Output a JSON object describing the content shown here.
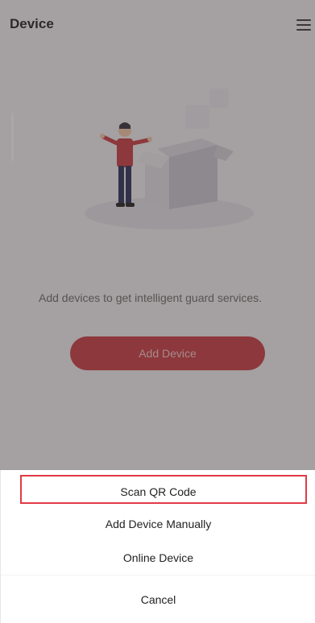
{
  "header": {
    "title": "Device"
  },
  "empty_state": {
    "message": "Add devices to get intelligent guard services.",
    "add_device_label": "Add Device"
  },
  "action_sheet": {
    "scan_qr_label": "Scan QR Code",
    "add_manually_label": "Add Device Manually",
    "online_device_label": "Online Device",
    "cancel_label": "Cancel"
  },
  "colors": {
    "accent": "#c6353d",
    "highlight": "#e03a45"
  },
  "icons": {
    "menu": "hamburger-menu-icon"
  }
}
